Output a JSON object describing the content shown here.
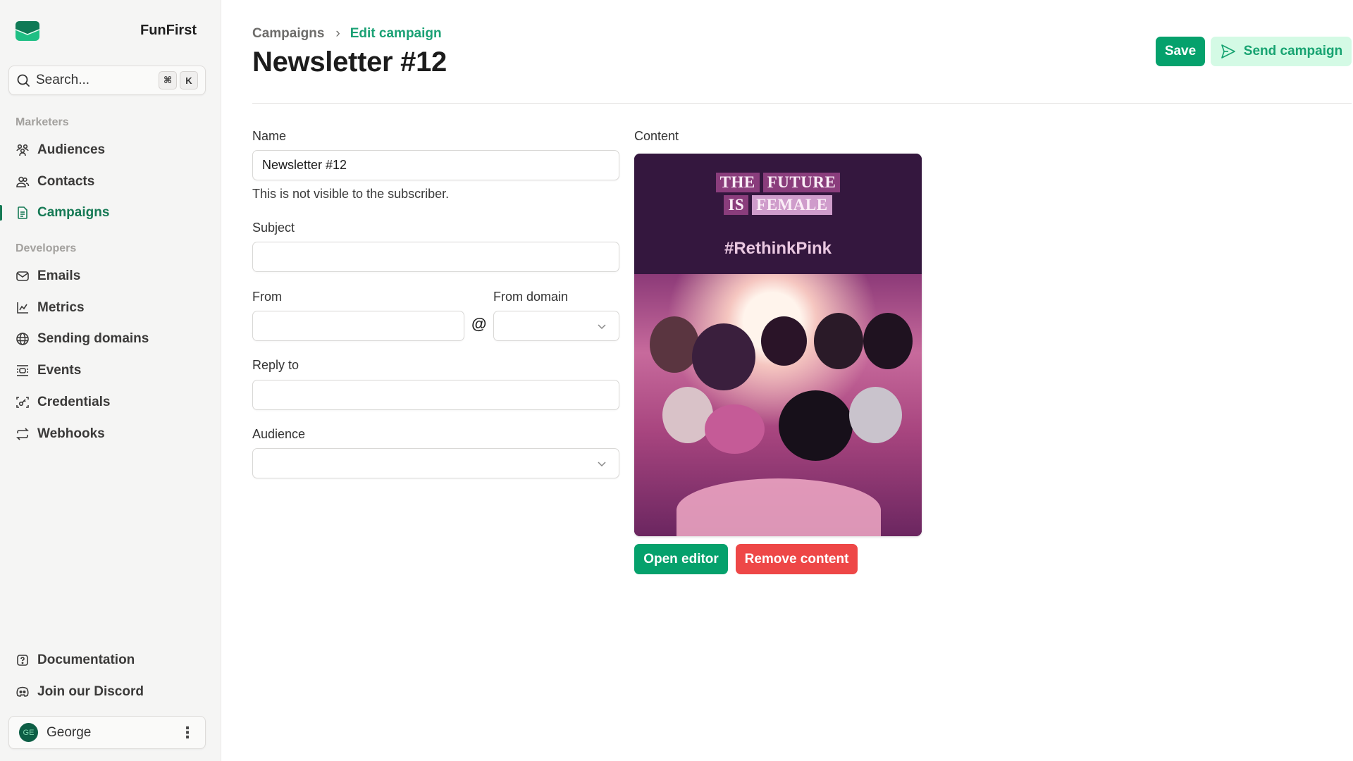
{
  "sidebar": {
    "brand": "FunFirst",
    "search": {
      "placeholder": "Search...",
      "shortcut_keys": [
        "⌘",
        "K"
      ]
    },
    "sections": [
      {
        "label": "Marketers",
        "items": [
          {
            "label": "Audiences",
            "icon": "users-group-icon",
            "active": false
          },
          {
            "label": "Contacts",
            "icon": "contacts-icon",
            "active": false
          },
          {
            "label": "Campaigns",
            "icon": "document-icon",
            "active": true
          }
        ]
      },
      {
        "label": "Developers",
        "items": [
          {
            "label": "Emails",
            "icon": "mail-icon",
            "active": false
          },
          {
            "label": "Metrics",
            "icon": "chart-line-icon",
            "active": false
          },
          {
            "label": "Sending domains",
            "icon": "globe-icon",
            "active": false
          },
          {
            "label": "Events",
            "icon": "events-icon",
            "active": false
          },
          {
            "label": "Credentials",
            "icon": "key-scan-icon",
            "active": false
          },
          {
            "label": "Webhooks",
            "icon": "arrows-repeat-icon",
            "active": false
          }
        ]
      }
    ],
    "footer_links": [
      {
        "label": "Documentation",
        "icon": "help-icon"
      },
      {
        "label": "Join our Discord",
        "icon": "discord-icon"
      }
    ],
    "user": {
      "initials": "GE",
      "name": "George",
      "menu_icon": "⋮"
    }
  },
  "header": {
    "breadcrumb": {
      "root": "Campaigns",
      "separator": "›",
      "current": "Edit campaign"
    },
    "title": "Newsletter #12",
    "save_label": "Save",
    "send_label": "Send campaign"
  },
  "form": {
    "name": {
      "label": "Name",
      "value": "Newsletter #12",
      "helper": "This is not visible to the subscriber."
    },
    "subject": {
      "label": "Subject",
      "value": ""
    },
    "from": {
      "label": "From",
      "value": "",
      "at_symbol": "@"
    },
    "from_domain": {
      "label": "From domain",
      "value": ""
    },
    "reply_to": {
      "label": "Reply to",
      "value": ""
    },
    "audience": {
      "label": "Audience",
      "value": ""
    }
  },
  "content": {
    "label": "Content",
    "preview": {
      "headline_line1": [
        "THE",
        "FUTURE"
      ],
      "headline_line2": [
        "IS",
        "FEMALE"
      ],
      "hashtag": "#RethinkPink",
      "image_description": "Illustration of a group of smiling women in pink tones"
    },
    "open_editor_label": "Open editor",
    "remove_label": "Remove content"
  },
  "colors": {
    "accent": "#05a16c",
    "accent_light": "#d4fae5",
    "danger": "#ee4747",
    "sidebar_bg": "#f5f5f4"
  }
}
